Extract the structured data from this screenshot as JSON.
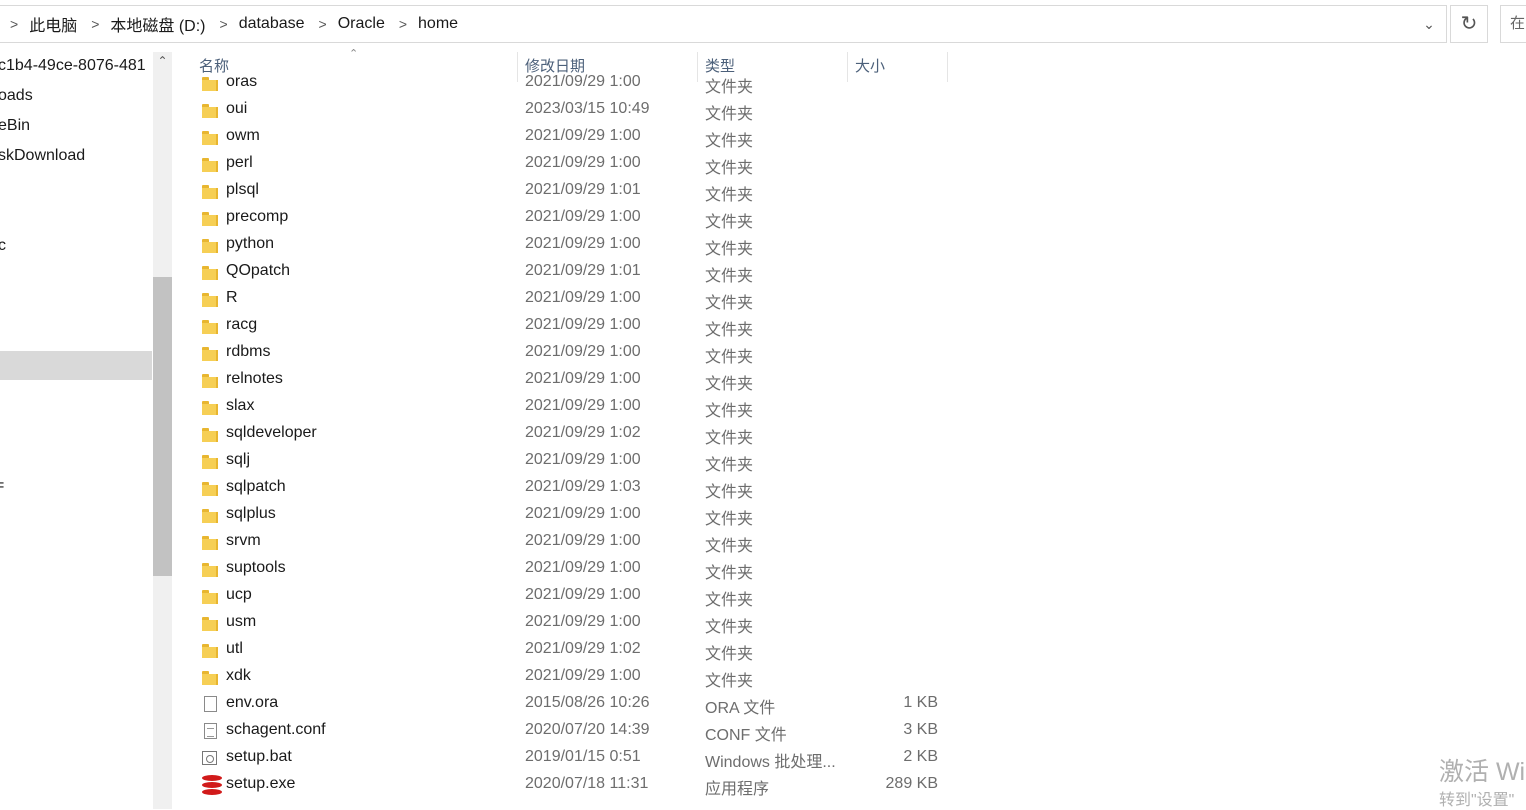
{
  "address_bar": {
    "crumbs": [
      "此电脑",
      "本地磁盘 (D:)",
      "database",
      "Oracle",
      "home"
    ],
    "search_placeholder": "在"
  },
  "nav_pane": {
    "items": [
      "c1b4-49ce-8076-481",
      "oads",
      "eBin",
      "skDownload",
      "c",
      "="
    ]
  },
  "columns": {
    "name": "名称",
    "date": "修改日期",
    "type": "类型",
    "size": "大小"
  },
  "files": [
    {
      "name": "oras",
      "date": "2021/09/29 1:00",
      "type": "文件夹",
      "size": "",
      "icon": "folder-icon"
    },
    {
      "name": "oui",
      "date": "2023/03/15 10:49",
      "type": "文件夹",
      "size": "",
      "icon": "folder-icon"
    },
    {
      "name": "owm",
      "date": "2021/09/29 1:00",
      "type": "文件夹",
      "size": "",
      "icon": "folder-icon"
    },
    {
      "name": "perl",
      "date": "2021/09/29 1:00",
      "type": "文件夹",
      "size": "",
      "icon": "folder-icon"
    },
    {
      "name": "plsql",
      "date": "2021/09/29 1:01",
      "type": "文件夹",
      "size": "",
      "icon": "folder-icon"
    },
    {
      "name": "precomp",
      "date": "2021/09/29 1:00",
      "type": "文件夹",
      "size": "",
      "icon": "folder-icon"
    },
    {
      "name": "python",
      "date": "2021/09/29 1:00",
      "type": "文件夹",
      "size": "",
      "icon": "folder-icon"
    },
    {
      "name": "QOpatch",
      "date": "2021/09/29 1:01",
      "type": "文件夹",
      "size": "",
      "icon": "folder-icon"
    },
    {
      "name": "R",
      "date": "2021/09/29 1:00",
      "type": "文件夹",
      "size": "",
      "icon": "folder-icon"
    },
    {
      "name": "racg",
      "date": "2021/09/29 1:00",
      "type": "文件夹",
      "size": "",
      "icon": "folder-icon"
    },
    {
      "name": "rdbms",
      "date": "2021/09/29 1:00",
      "type": "文件夹",
      "size": "",
      "icon": "folder-icon"
    },
    {
      "name": "relnotes",
      "date": "2021/09/29 1:00",
      "type": "文件夹",
      "size": "",
      "icon": "folder-icon"
    },
    {
      "name": "slax",
      "date": "2021/09/29 1:00",
      "type": "文件夹",
      "size": "",
      "icon": "folder-icon"
    },
    {
      "name": "sqldeveloper",
      "date": "2021/09/29 1:02",
      "type": "文件夹",
      "size": "",
      "icon": "folder-icon"
    },
    {
      "name": "sqlj",
      "date": "2021/09/29 1:00",
      "type": "文件夹",
      "size": "",
      "icon": "folder-icon"
    },
    {
      "name": "sqlpatch",
      "date": "2021/09/29 1:03",
      "type": "文件夹",
      "size": "",
      "icon": "folder-icon"
    },
    {
      "name": "sqlplus",
      "date": "2021/09/29 1:00",
      "type": "文件夹",
      "size": "",
      "icon": "folder-icon"
    },
    {
      "name": "srvm",
      "date": "2021/09/29 1:00",
      "type": "文件夹",
      "size": "",
      "icon": "folder-icon"
    },
    {
      "name": "suptools",
      "date": "2021/09/29 1:00",
      "type": "文件夹",
      "size": "",
      "icon": "folder-icon"
    },
    {
      "name": "ucp",
      "date": "2021/09/29 1:00",
      "type": "文件夹",
      "size": "",
      "icon": "folder-icon"
    },
    {
      "name": "usm",
      "date": "2021/09/29 1:00",
      "type": "文件夹",
      "size": "",
      "icon": "folder-icon"
    },
    {
      "name": "utl",
      "date": "2021/09/29 1:02",
      "type": "文件夹",
      "size": "",
      "icon": "folder-icon"
    },
    {
      "name": "xdk",
      "date": "2021/09/29 1:00",
      "type": "文件夹",
      "size": "",
      "icon": "folder-icon"
    },
    {
      "name": "env.ora",
      "date": "2015/08/26 10:26",
      "type": "ORA 文件",
      "size": "1 KB",
      "icon": "file-icon"
    },
    {
      "name": "schagent.conf",
      "date": "2020/07/20 14:39",
      "type": "CONF 文件",
      "size": "3 KB",
      "icon": "text-file-icon"
    },
    {
      "name": "setup.bat",
      "date": "2019/01/15 0:51",
      "type": "Windows 批处理...",
      "size": "2 KB",
      "icon": "batch-file-icon"
    },
    {
      "name": "setup.exe",
      "date": "2020/07/18 11:31",
      "type": "应用程序",
      "size": "289 KB",
      "icon": "database-exe-icon"
    }
  ],
  "watermark": {
    "line1": "激活 Wi",
    "line2": "转到\"设置\""
  },
  "colors": {
    "header_text": "#4c607a",
    "folder": "#f6cf55",
    "selection": "#d9d9d9",
    "exe_red": "#d11a1a"
  }
}
